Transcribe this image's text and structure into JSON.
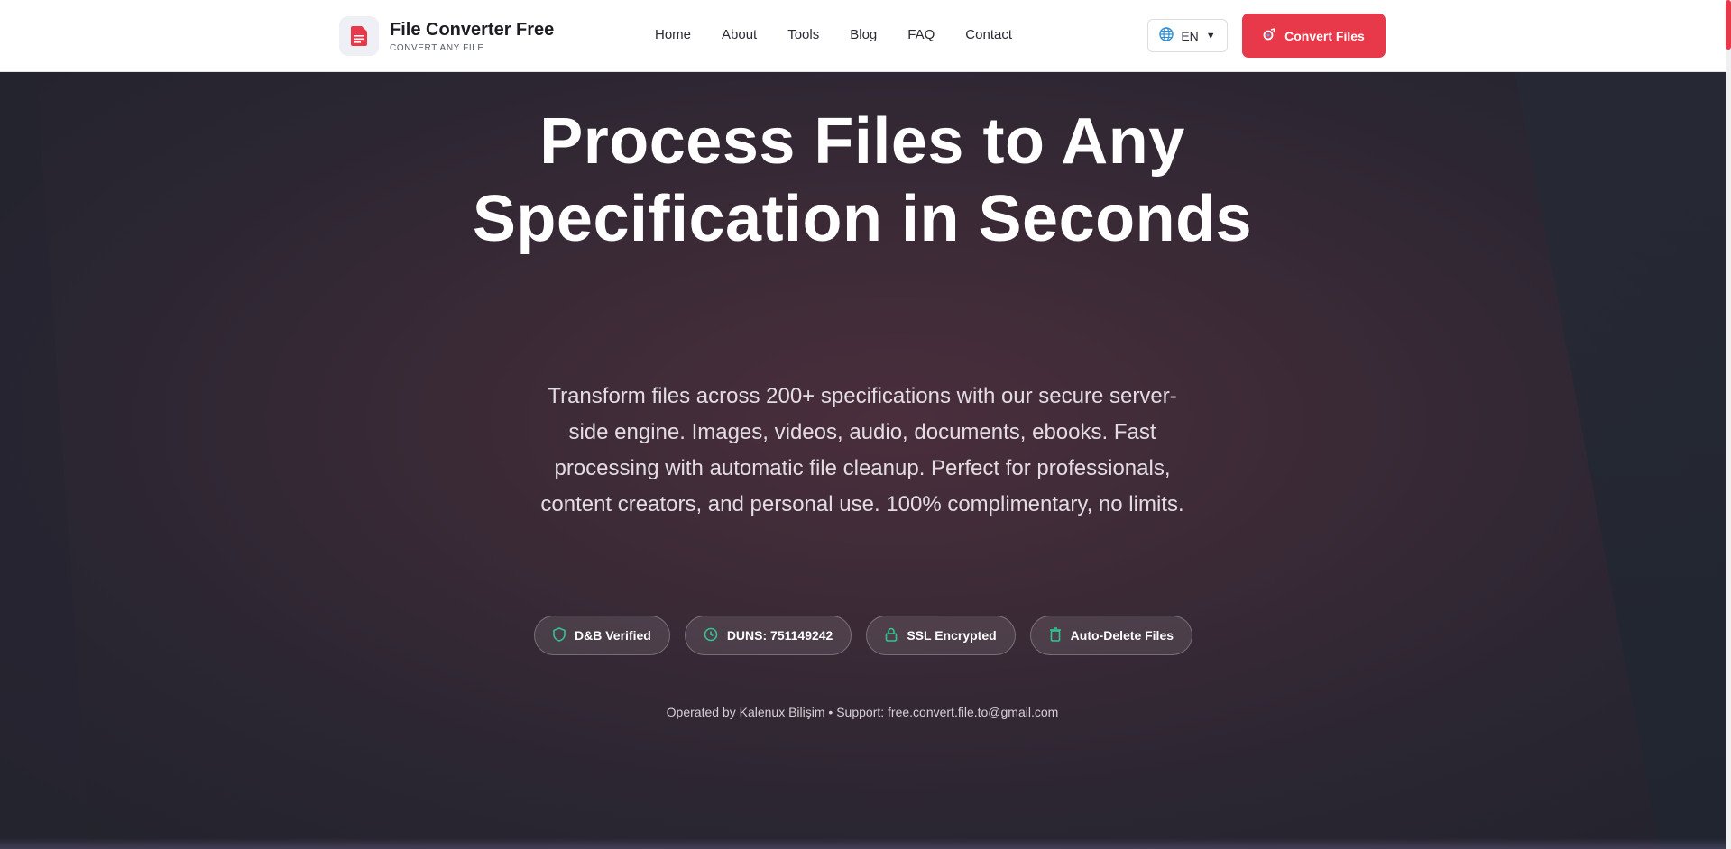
{
  "header": {
    "logo_title": "File Converter Free",
    "logo_subtitle": "CONVERT ANY FILE",
    "nav": [
      "Home",
      "About",
      "Tools",
      "Blog",
      "FAQ",
      "Contact"
    ],
    "language": "EN",
    "cta_label": "Convert Files"
  },
  "hero": {
    "headline": "Process Files to Any Specification in Seconds",
    "subtext": "Transform files across 200+ specifications with our secure server-side engine. Images, videos, audio, documents, ebooks. Fast processing with automatic file cleanup. Perfect for professionals, content creators, and personal use. 100% complimentary, no limits.",
    "badges": [
      {
        "label": "D&B Verified",
        "icon": "shield-icon"
      },
      {
        "label": "DUNS: 751149242",
        "icon": "clock-icon"
      },
      {
        "label": "SSL Encrypted",
        "icon": "lock-icon"
      },
      {
        "label": "Auto-Delete Files",
        "icon": "trash-icon"
      }
    ],
    "footer": "Operated by Kalenux Bilişim • Support: free.convert.file.to@gmail.com"
  },
  "colors": {
    "accent": "#e8394a",
    "badge_icon": "#34c38f",
    "globe_icon": "#2a8fd6"
  }
}
